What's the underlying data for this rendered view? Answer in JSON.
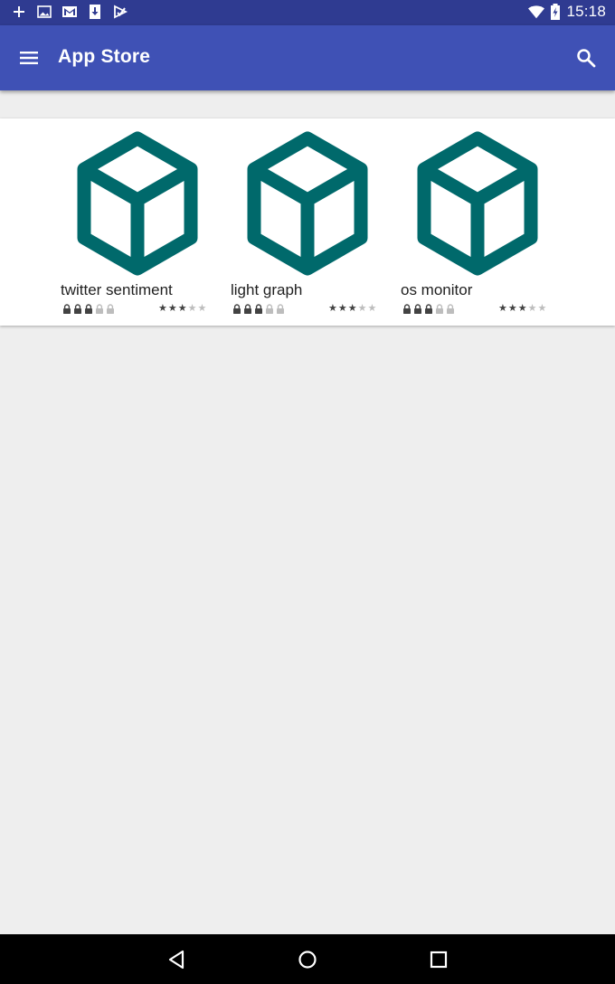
{
  "status_bar": {
    "time": "15:18",
    "left_icons": [
      "plus-icon",
      "image-icon",
      "gmail-icon",
      "download-icon",
      "play-store-icon"
    ],
    "right_icons": [
      "wifi-icon",
      "battery-charging-icon"
    ]
  },
  "app_bar": {
    "title": "App Store",
    "menu_icon": "hamburger-menu-icon",
    "search_icon": "search-icon",
    "color": "#3f51b5",
    "status_color": "#2f3b91"
  },
  "apps": [
    {
      "name": "twitter sentiment",
      "icon": "cube-icon",
      "locks_filled": 3,
      "locks_total": 5,
      "stars_filled": 3,
      "stars_total": 5
    },
    {
      "name": "light graph",
      "icon": "cube-icon",
      "locks_filled": 3,
      "locks_total": 5,
      "stars_filled": 3,
      "stars_total": 5
    },
    {
      "name": "os monitor",
      "icon": "cube-icon",
      "locks_filled": 3,
      "locks_total": 5,
      "stars_filled": 3,
      "stars_total": 5
    }
  ],
  "icon_color": "#00696b",
  "nav_bar": {
    "buttons": [
      "back-icon",
      "home-icon",
      "recents-icon"
    ]
  }
}
